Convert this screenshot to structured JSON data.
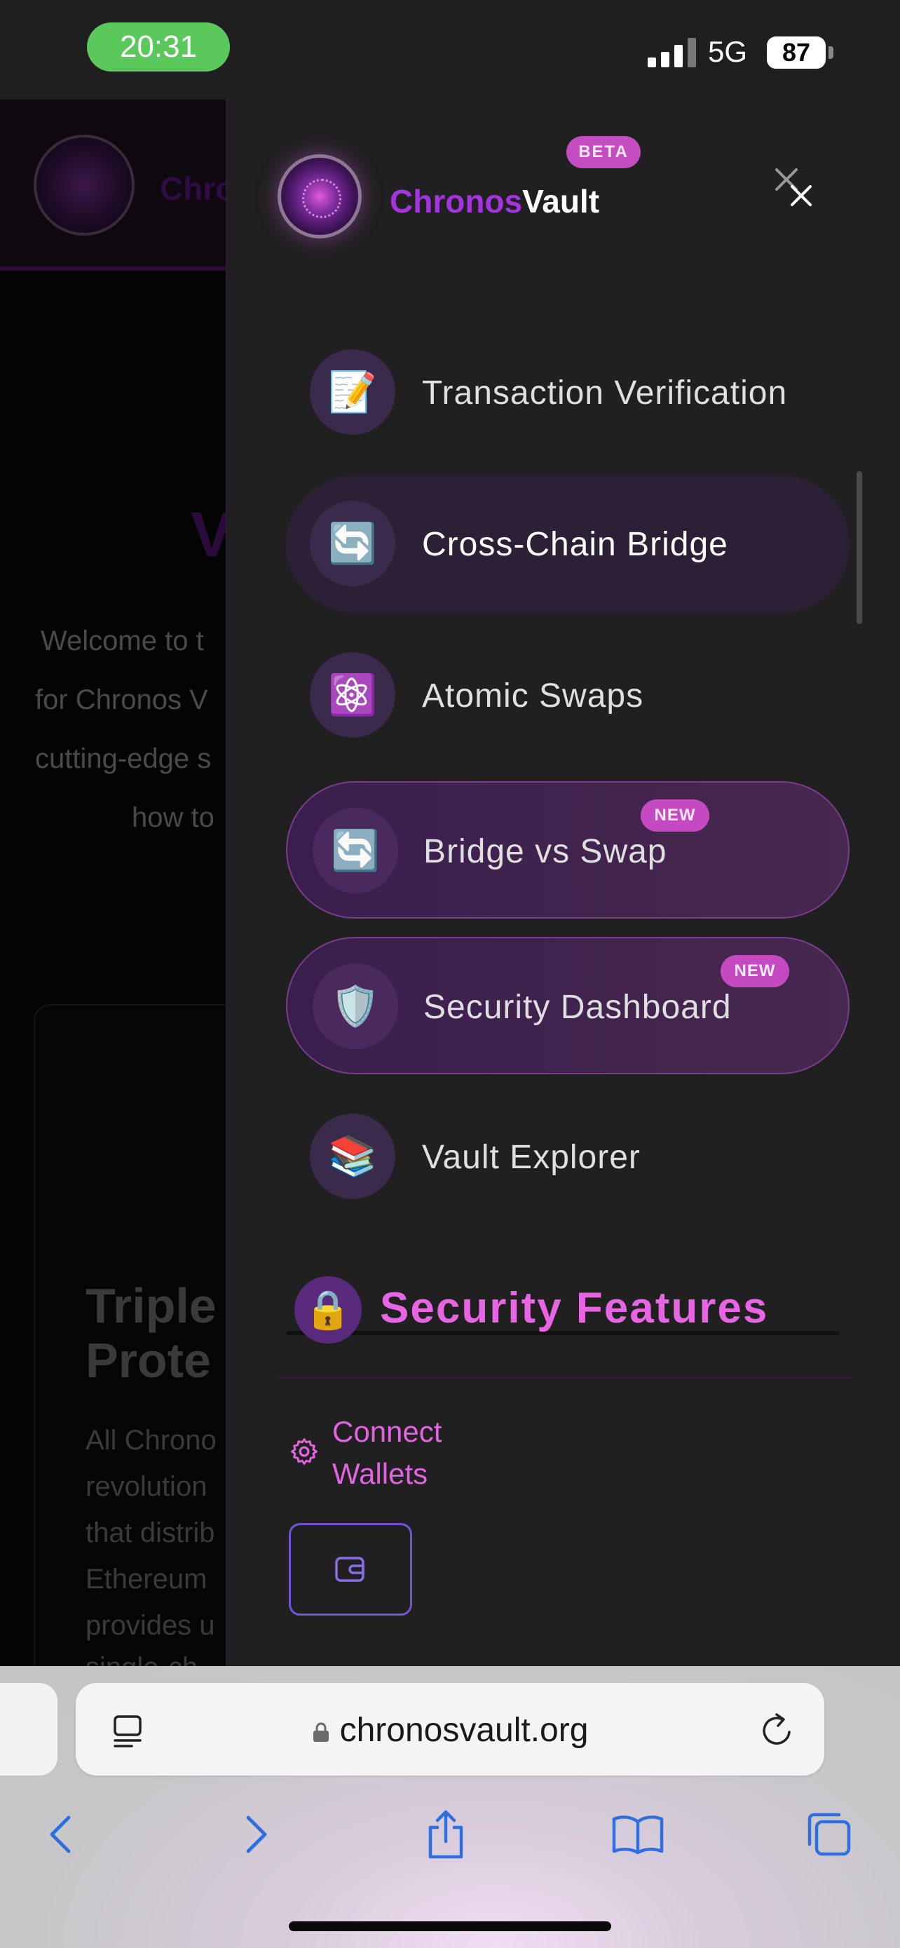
{
  "status_bar": {
    "time": "20:31",
    "network": "5G",
    "battery": "87"
  },
  "background_page": {
    "brand_fragment": "Chro",
    "heading_fragment": "V",
    "intro_lines": [
      "Welcome to t",
      "for Chronos V",
      "cutting-edge s",
      "how to"
    ],
    "card_title_lines": [
      "Triple",
      "Prote"
    ],
    "card_text_lines": [
      "All Chrono",
      "revolution",
      "that distrib",
      "Ethereum",
      "provides u",
      "single-ch"
    ]
  },
  "drawer": {
    "brand_part1": "Chronos",
    "brand_part2": "Vault",
    "beta_label": "BETA",
    "nav_items": [
      {
        "label": "Transaction Verification",
        "icon": "memo-icon",
        "glyph": "📝"
      },
      {
        "label": "Cross-Chain Bridge",
        "icon": "arrows-cycle-icon",
        "glyph": "🔄",
        "active": true
      },
      {
        "label": "Atomic Swaps",
        "icon": "atom-icon",
        "glyph": "⚛️"
      },
      {
        "label": "Bridge vs Swap",
        "icon": "arrows-cycle-icon",
        "glyph": "🔄",
        "badge": "NEW"
      },
      {
        "label": "Security Dashboard",
        "icon": "shield-icon",
        "glyph": "🛡️",
        "badge": "NEW"
      },
      {
        "label": "Vault Explorer",
        "icon": "books-icon",
        "glyph": "📚"
      }
    ],
    "section_title": "Security Features",
    "section_glyph": "🔒",
    "connect_label": "Connect Wallets"
  },
  "browser": {
    "url": "chronosvault.org"
  },
  "colors": {
    "accent_purple": "#a534e0",
    "accent_pink": "#e765e3",
    "badge": "#c54ac2",
    "drawer_bg": "#202020"
  }
}
